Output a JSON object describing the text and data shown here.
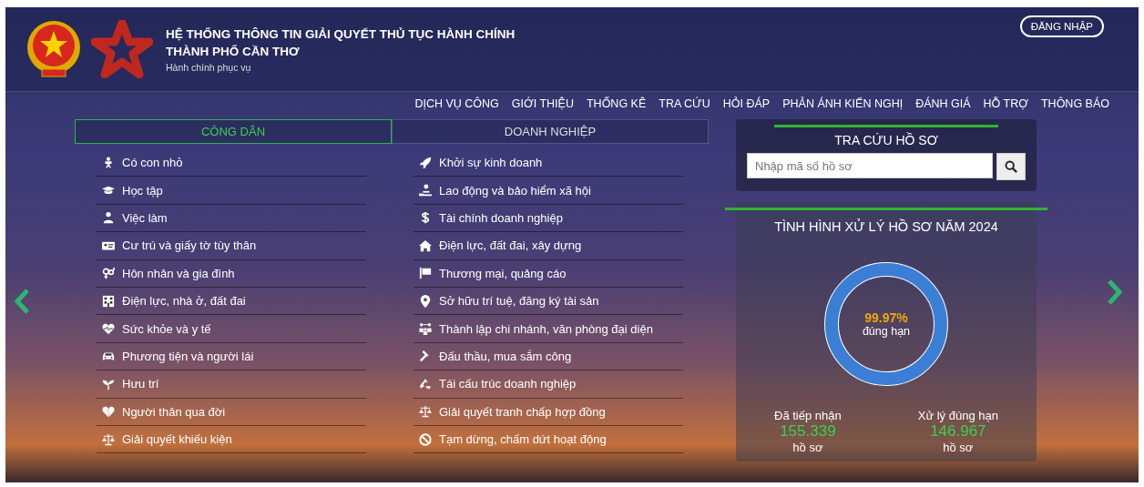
{
  "header": {
    "title_line_1": "HỆ THỐNG THÔNG TIN GIẢI QUYẾT THỦ TỤC HÀNH CHÍNH",
    "title_line_2": "THÀNH PHỐ CẦN THƠ",
    "slogan": "Hành chính phục vụ",
    "login_button": "ĐĂNG NHẬP"
  },
  "nav": [
    "DỊCH VỤ CÔNG",
    "GIỚI THIỆU",
    "THỐNG KÊ",
    "TRA CỨU",
    "HỎI ĐÁP",
    "PHẢN ÁNH KIẾN NGHỊ",
    "ĐÁNH GIÁ",
    "HỖ TRỢ",
    "THÔNG BÁO"
  ],
  "tabs": [
    {
      "label": "CÔNG DÂN",
      "selected": true
    },
    {
      "label": "DOANH NGHIỆP",
      "selected": false
    }
  ],
  "citizen_services": [
    "Có con nhỏ",
    "Học tập",
    "Việc làm",
    "Cư trú và giấy tờ tùy thân",
    "Hôn nhân và gia đình",
    "Điện lực, nhà ở, đất đai",
    "Sức khỏe và y tế",
    "Phương tiện và người lái",
    "Hưu trí",
    "Người thân qua đời",
    "Giải quyết khiếu kiện"
  ],
  "business_services": [
    "Khởi sự kinh doanh",
    "Lao động và bảo hiểm xã hội",
    "Tài chính doanh nghiệp",
    "Điện lực, đất đai, xây dựng",
    "Thương mại, quảng cáo",
    "Sở hữu trí tuệ, đăng ký tài sản",
    "Thành lập chi nhánh, văn phòng đại diện",
    "Đấu thầu, mua sắm công",
    "Tái cấu trúc doanh nghiệp",
    "Giải quyết tranh chấp hợp đồng",
    "Tạm dừng, chấm dứt hoạt động"
  ],
  "lookup": {
    "title": "TRA CỨU HỒ SƠ",
    "placeholder": "Nhập mã số hồ sơ"
  },
  "stats": {
    "title": "TÌNH HÌNH XỬ LÝ HỒ SƠ NĂM 2024",
    "level": 0.9997,
    "percent": "99.97%",
    "percent_caption": "đúng hạn",
    "figures": [
      {
        "label": "Đã tiếp nhận",
        "value": "155.339",
        "unit": "hồ sơ"
      },
      {
        "label": "Xử lý đúng hạn",
        "value": "146.967",
        "unit": "hồ sơ"
      }
    ]
  }
}
